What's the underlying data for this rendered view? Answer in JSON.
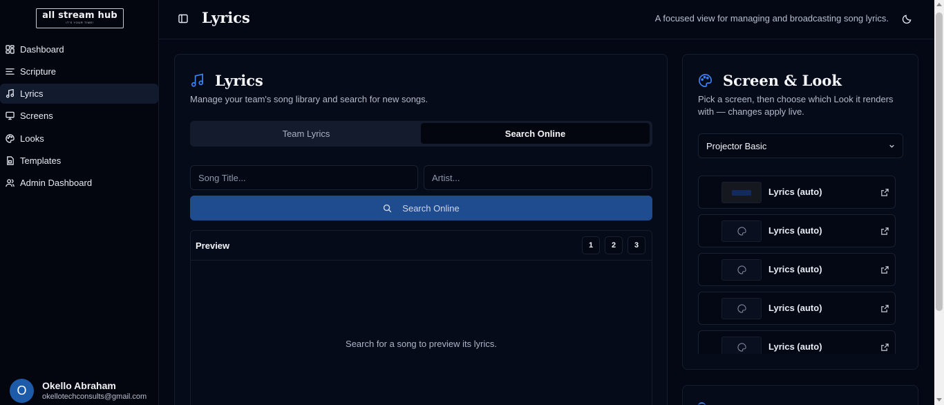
{
  "app": {
    "logo_text": "all stream hub",
    "logo_tagline": "IT'S YOUR TIME!"
  },
  "sidebar": {
    "items": [
      {
        "label": "Dashboard",
        "icon": "dashboard-icon"
      },
      {
        "label": "Scripture",
        "icon": "list-icon"
      },
      {
        "label": "Lyrics",
        "icon": "music-icon",
        "active": true
      },
      {
        "label": "Screens",
        "icon": "monitor-icon"
      },
      {
        "label": "Looks",
        "icon": "palette-icon"
      },
      {
        "label": "Templates",
        "icon": "template-icon"
      },
      {
        "label": "Admin Dashboard",
        "icon": "users-icon"
      }
    ]
  },
  "user": {
    "initial": "O",
    "name": "Okello Abraham",
    "email": "okellotechconsults@gmail.com"
  },
  "header": {
    "title": "Lyrics",
    "description": "A focused view for managing and broadcasting song lyrics."
  },
  "lyrics_card": {
    "title": "Lyrics",
    "description": "Manage your team's song library and search for new songs.",
    "tabs": [
      {
        "label": "Team Lyrics",
        "active": false
      },
      {
        "label": "Search Online",
        "active": true
      }
    ],
    "song_title_placeholder": "Song Title...",
    "artist_placeholder": "Artist...",
    "search_button": "Search Online",
    "preview_label": "Preview",
    "pages": [
      "1",
      "2",
      "3"
    ],
    "empty_text": "Search for a song to preview its lyrics."
  },
  "look_card": {
    "title": "Screen & Look",
    "description_line1": "Pick a screen, then choose which Look it renders",
    "description_line2": "with — changes apply live.",
    "selected_screen": "Projector Basic",
    "looks": [
      {
        "label": "Lyrics (auto)",
        "thumb": "lyrics-preview"
      },
      {
        "label": "Lyrics (auto)",
        "thumb": "palette-icon"
      },
      {
        "label": "Lyrics (auto)",
        "thumb": "palette-icon"
      },
      {
        "label": "Lyrics (auto)",
        "thumb": "palette-icon"
      },
      {
        "label": "Lyrics (auto)",
        "thumb": "palette-icon"
      }
    ]
  },
  "colors": {
    "background": "#040815",
    "card": "#060b1a",
    "accent": "#3b82f6",
    "primary_button": "#1f4b8f"
  }
}
